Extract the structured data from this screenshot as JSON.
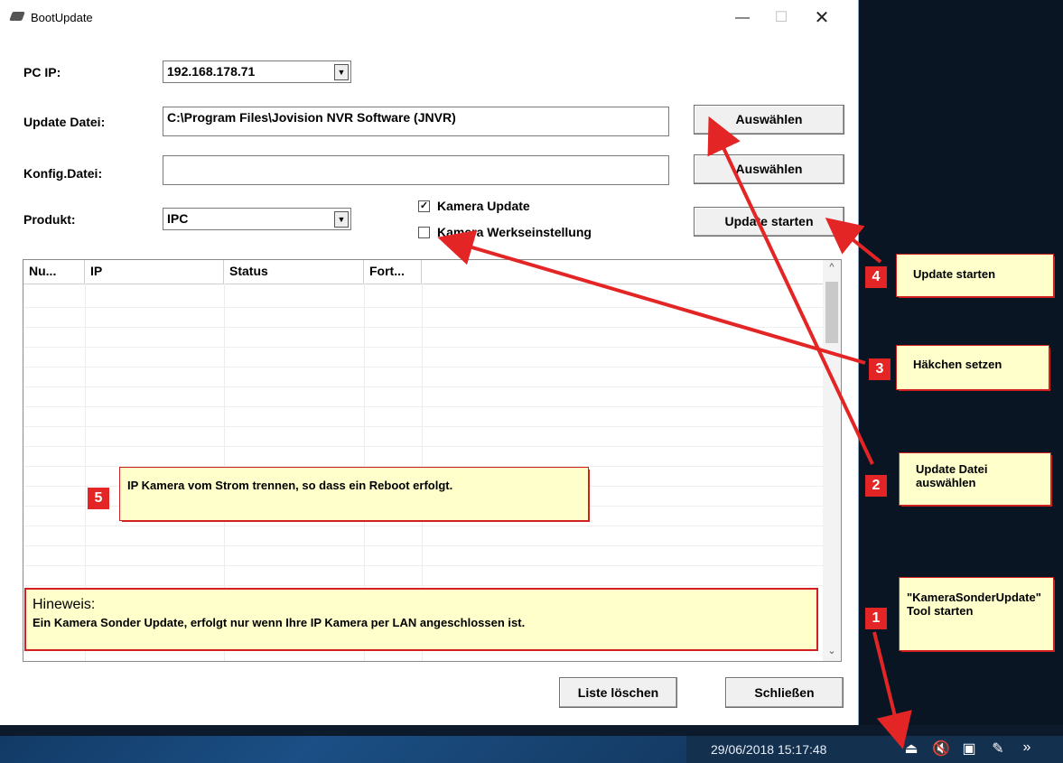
{
  "window": {
    "title": "BootUpdate",
    "minimize": "—",
    "maximize": "☐",
    "close": "✕"
  },
  "form": {
    "pc_ip_label": "PC IP:",
    "pc_ip_value": "192.168.178.71",
    "update_file_label": "Update Datei:",
    "update_file_value": "C:\\Program Files\\Jovision NVR Software (JNVR)",
    "select_button": "Auswählen",
    "config_file_label": "Konfig.Datei:",
    "config_file_value": "",
    "select_button_2": "Auswählen",
    "product_label": "Produkt:",
    "product_value": "IPC",
    "camera_update_label": "Kamera Update",
    "camera_update_checked": "☑",
    "factory_reset_label": "Kamera Werkseinstellung",
    "start_update_button": "Update starten"
  },
  "table": {
    "columns": [
      "Nu...",
      "IP",
      "Status",
      "Fort..."
    ]
  },
  "footer": {
    "clear_list_button": "Liste löschen",
    "close_button": "Schließen"
  },
  "annotations": {
    "note1_num": "1",
    "note1_text": "\"KameraSonderUpdate\" Tool starten",
    "note2_num": "2",
    "note2_text": "Update Datei auswählen",
    "note3_num": "3",
    "note3_text": "Häkchen setzen",
    "note4_num": "4",
    "note4_text": "Update starten",
    "note5_num": "5",
    "note5_text": "IP Kamera vom Strom trennen, so dass ein Reboot erfolgt.",
    "hint_title": "Hineweis:",
    "hint_text": "Ein Kamera Sonder Update, erfolgt nur wenn Ihre IP Kamera per LAN angeschlossen ist."
  },
  "taskbar": {
    "clock": "29/06/2018 15:17:48",
    "tray_icons": [
      "eject-icon",
      "speaker-muted-icon",
      "network-icon",
      "pin-icon",
      "chevron-down-icon"
    ]
  },
  "colors": {
    "annotation_bg": "#ffffcc",
    "annotation_border": "#d02020",
    "badge": "#e42525"
  }
}
